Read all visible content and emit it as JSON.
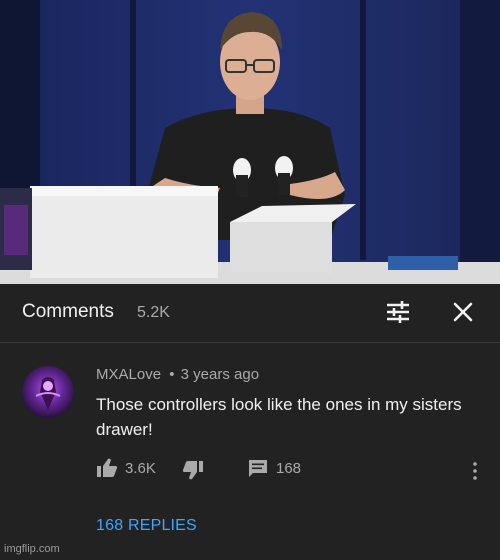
{
  "comments_header": {
    "title": "Comments",
    "count": "5.2K"
  },
  "comment": {
    "author": "MXALove",
    "separator": "•",
    "time": "3 years ago",
    "text": "Those controllers look like the ones in my sisters drawer!",
    "likes": "3.6K",
    "reply_count": "168",
    "replies_label": "168 REPLIES"
  },
  "icons": {
    "filter": "sliders-icon",
    "close": "close-icon",
    "like": "thumbs-up-icon",
    "dislike": "thumbs-down-icon",
    "reply": "comment-icon",
    "more": "more-vert-icon"
  },
  "colors": {
    "background": "#222222",
    "text_primary": "#f1f1f1",
    "text_secondary": "#aaaaaa",
    "link": "#3ea6ff"
  },
  "watermark": "imgflip.com"
}
